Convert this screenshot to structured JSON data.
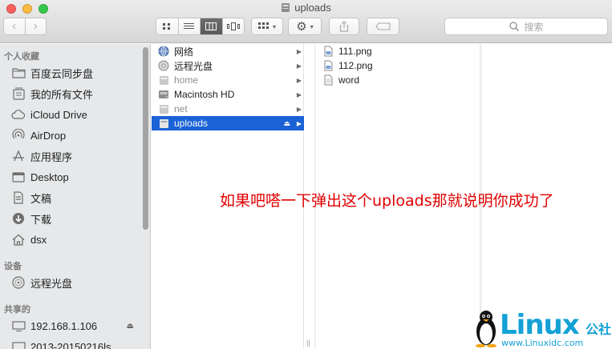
{
  "window": {
    "title": "uploads"
  },
  "toolbar": {
    "back_icon": "chevron-left",
    "forward_icon": "chevron-right",
    "search_placeholder": "搜索"
  },
  "sidebar": {
    "favorites_header": "个人收藏",
    "favorites": [
      {
        "label": "百度云同步盘",
        "icon": "folder"
      },
      {
        "label": "我的所有文件",
        "icon": "all-files"
      },
      {
        "label": "iCloud Drive",
        "icon": "cloud"
      },
      {
        "label": "AirDrop",
        "icon": "airdrop"
      },
      {
        "label": "应用程序",
        "icon": "applications"
      },
      {
        "label": "Desktop",
        "icon": "desktop"
      },
      {
        "label": "文稿",
        "icon": "documents"
      },
      {
        "label": "下载",
        "icon": "download"
      },
      {
        "label": "dsx",
        "icon": "home"
      }
    ],
    "devices_header": "设备",
    "devices": [
      {
        "label": "远程光盘",
        "icon": "disc"
      }
    ],
    "shared_header": "共享的",
    "shared": [
      {
        "label": "192.168.1.106",
        "icon": "monitor"
      },
      {
        "label": "2013-20150216ls",
        "icon": "monitor"
      }
    ]
  },
  "column1": [
    {
      "label": "网络",
      "icon": "globe",
      "dim": false,
      "selected": false
    },
    {
      "label": "远程光盘",
      "icon": "disc",
      "dim": false,
      "selected": false
    },
    {
      "label": "home",
      "icon": "drive",
      "dim": true,
      "selected": false
    },
    {
      "label": "Macintosh HD",
      "icon": "hard-drive",
      "dim": false,
      "selected": false
    },
    {
      "label": "net",
      "icon": "drive",
      "dim": true,
      "selected": false
    },
    {
      "label": "uploads",
      "icon": "drive",
      "dim": false,
      "selected": true
    }
  ],
  "column2": [
    {
      "label": "111.png",
      "icon": "png-file"
    },
    {
      "label": "112.png",
      "icon": "png-file"
    },
    {
      "label": "word",
      "icon": "text-file"
    }
  ],
  "annotation": "如果吧嗒一下弹出这个uploads那就说明你成功了",
  "watermark": {
    "brand": "Linux",
    "brand_cn": "公社",
    "url": "www.Linuxidc.com"
  }
}
